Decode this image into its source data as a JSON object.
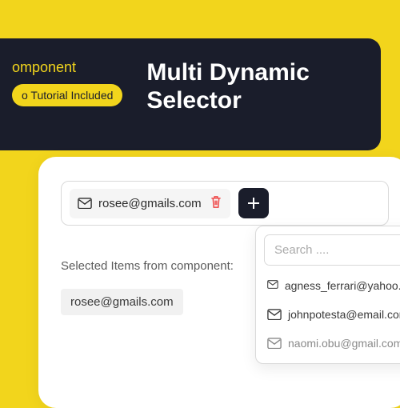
{
  "header": {
    "component_label": "omponent",
    "tutorial_pill": "o Tutorial Included",
    "title_line1": "Multi Dynamic",
    "title_line2": "Selector"
  },
  "selector": {
    "chip_email": "rosee@gmails.com"
  },
  "selected": {
    "label": "Selected Items from component:",
    "chip": "rosee@gmails.com"
  },
  "dropdown": {
    "search_placeholder": "Search ....",
    "items": [
      "agness_ferrari@yahoo.com",
      "johnpotesta@email.com",
      "naomi.obu@gmail.com"
    ]
  },
  "icons": {
    "envelope": "envelope-icon",
    "trash": "trash-icon",
    "plus": "plus-icon"
  }
}
